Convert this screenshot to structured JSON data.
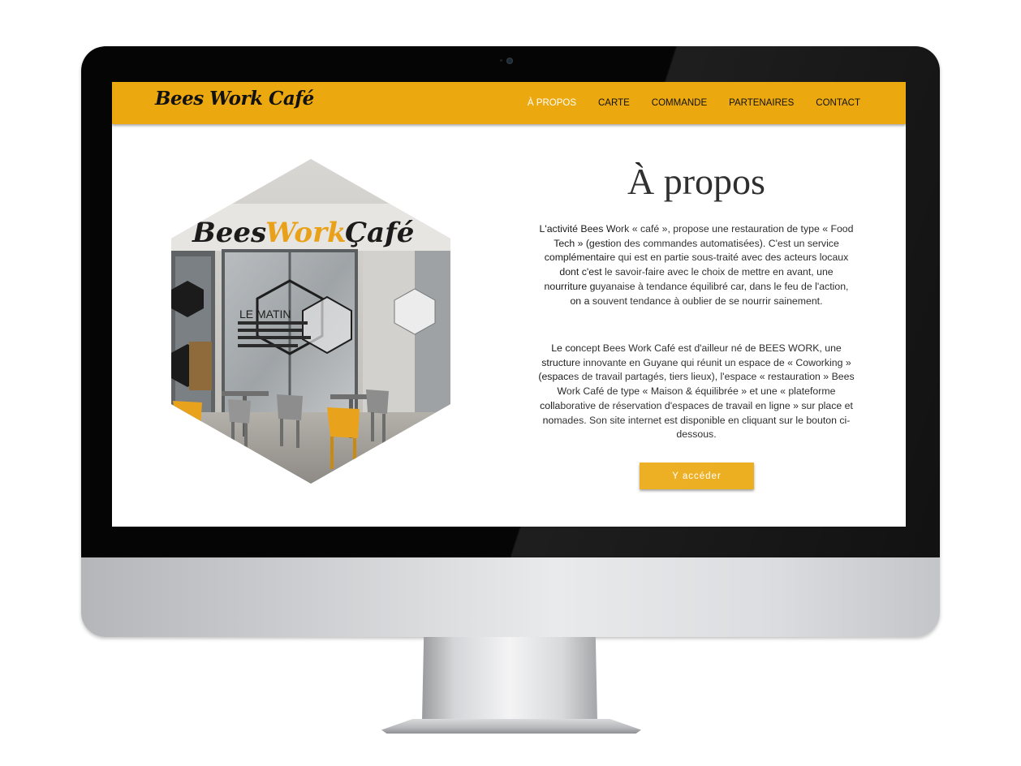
{
  "brand": {
    "logo_text": "Bees Work Café",
    "accent_color": "#eba80f"
  },
  "nav": {
    "items": [
      {
        "label": "À PROPOS",
        "active": true
      },
      {
        "label": "CARTE",
        "active": false
      },
      {
        "label": "COMMANDE",
        "active": false
      },
      {
        "label": "PARTENAIRES",
        "active": false
      },
      {
        "label": "CONTACT",
        "active": false
      }
    ]
  },
  "main": {
    "title": "À propos",
    "paragraph_1": "L'activité Bees Work « café », propose une restauration de type « Food Tech » (gestion des commandes automatisées). C'est un service complémentaire qui est en partie sous-traité avec des acteurs locaux dont c'est le savoir-faire avec le choix de mettre en avant, une nourriture guyanaise à tendance équilibré car, dans le feu de l'action, on a souvent tendance à oublier de se nourrir sainement.",
    "paragraph_2": "Le concept Bees Work Café est d'ailleur né de BEES WORK, une structure innovante en Guyane qui réunit un espace de « Coworking » (espaces de travail partagés, tiers lieux), l'espace « restauration » Bees Work Café de type « Maison & équilibrée » et une « plateforme collaborative de réservation d'espaces de travail en ligne » sur place et nomades. Son site internet est disponible en cliquant sur le bouton ci-dessous.",
    "cta_label": "Y accéder"
  },
  "photo": {
    "sign_text_bees": "Bees",
    "sign_text_work": "Work",
    "sign_text_cafe": "Çafé",
    "window_text": "LE MATIN"
  }
}
